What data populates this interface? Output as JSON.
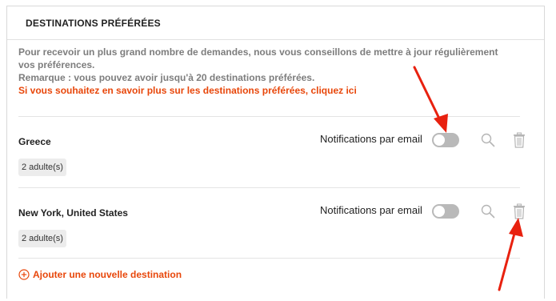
{
  "section": {
    "title": "DESTINATIONS PRÉFÉRÉES",
    "intro_line1": "Pour recevoir un plus grand nombre de demandes, nous vous conseillons de mettre à jour régulièrement vos préférences.",
    "intro_line2": "Remarque : vous pouvez avoir jusqu'à 20 destinations préférées.",
    "intro_link": "Si vous souhaitez en savoir plus sur les destinations préférées, cliquez ici"
  },
  "destinations": [
    {
      "name": "Greece",
      "travelers": "2 adulte(s)",
      "notif_label": "Notifications par email",
      "notif_enabled": false
    },
    {
      "name": "New York, United States",
      "travelers": "2 adulte(s)",
      "notif_label": "Notifications par email",
      "notif_enabled": false
    }
  ],
  "add_destination_label": "Ajouter une nouvelle destination",
  "colors": {
    "accent": "#e8470b",
    "annotation_arrow": "#e8210f",
    "toggle_off": "#b9b9b9"
  },
  "icons": {
    "search": "magnifier-icon",
    "delete": "trash-icon",
    "add": "plus-circle-icon"
  }
}
